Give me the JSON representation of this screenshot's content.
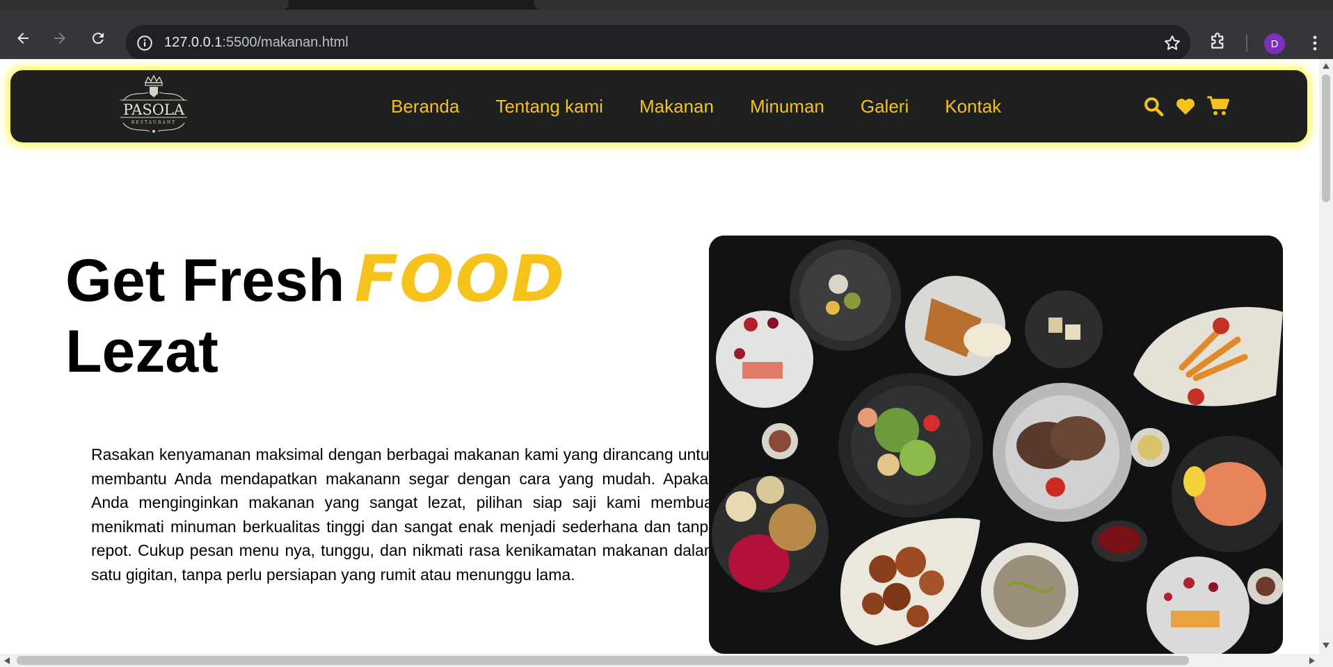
{
  "browser": {
    "url_host": "127.0.0.1",
    "url_path": ":5500/makanan.html",
    "profile_initial": "D"
  },
  "navbar": {
    "logo_text": "PASOLA",
    "logo_subtext": "RESTAURANT",
    "links": [
      "Beranda",
      "Tentang kami",
      "Makanan",
      "Minuman",
      "Galeri",
      "Kontak"
    ],
    "icons": [
      "search-icon",
      "heart-icon",
      "cart-icon"
    ]
  },
  "hero": {
    "title_part1": "Get Fresh",
    "title_accent": "FOOD",
    "title_part2": "Lezat",
    "paragraph": "Rasakan kenyamanan maksimal dengan berbagai makanan kami yang dirancang untuk membantu Anda mendapatkan makanann segar dengan cara yang mudah. Apakah Anda menginginkan makanan yang sangat lezat, pilihan siap saji kami membuat menikmati minuman berkualitas tinggi dan sangat enak menjadi sederhana dan tanpa repot. Cukup pesan menu nya, tunggu, dan nikmati rasa kenikamatan makanan dalam satu gigitan, tanpa perlu persiapan yang rumit atau menunggu lama."
  },
  "colors": {
    "accent": "#f6c21c",
    "navbar_bg": "#1e1f1f",
    "navbar_glow": "#fff200",
    "chrome_bg": "#35363a"
  }
}
